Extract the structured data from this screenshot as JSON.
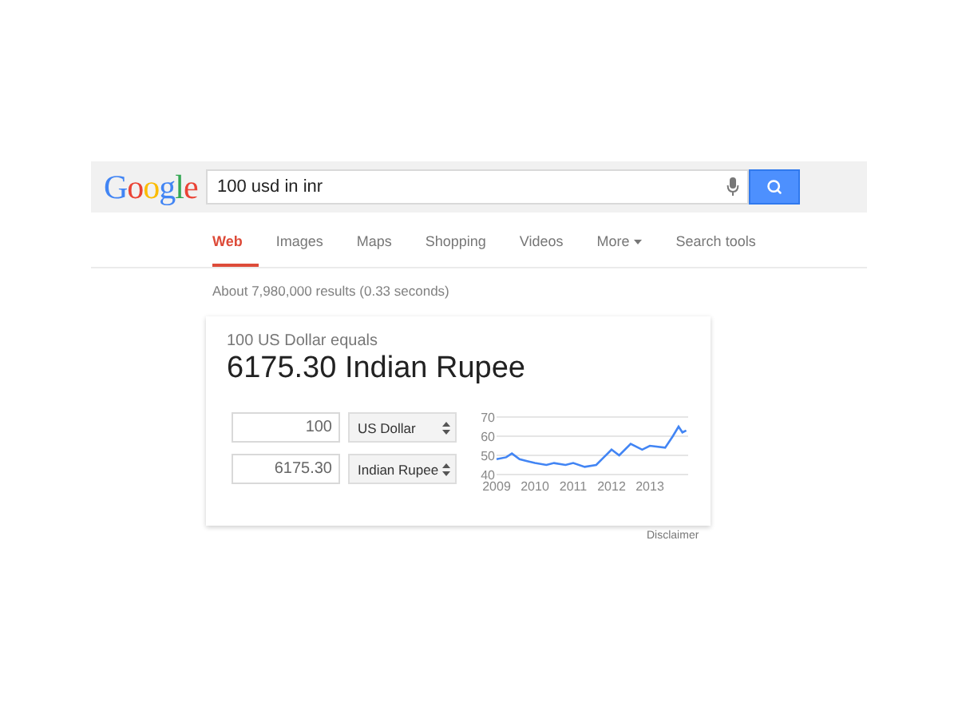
{
  "header": {
    "logo": "Google",
    "query": "100 usd in inr"
  },
  "tabs": [
    {
      "label": "Web",
      "selected": true,
      "dropdown": false
    },
    {
      "label": "Images",
      "selected": false,
      "dropdown": false
    },
    {
      "label": "Maps",
      "selected": false,
      "dropdown": false
    },
    {
      "label": "Shopping",
      "selected": false,
      "dropdown": false
    },
    {
      "label": "Videos",
      "selected": false,
      "dropdown": false
    },
    {
      "label": "More",
      "selected": false,
      "dropdown": true
    },
    {
      "label": "Search tools",
      "selected": false,
      "dropdown": false
    }
  ],
  "result_stats": "About 7,980,000 results (0.33 seconds)",
  "converter": {
    "caption": "100 US Dollar equals",
    "result": "6175.30 Indian Rupee",
    "rows": [
      {
        "amount": "100",
        "currency": "US Dollar"
      },
      {
        "amount": "6175.30",
        "currency": "Indian Rupee"
      }
    ],
    "chart_data": {
      "type": "line",
      "x": [
        2009.0,
        2009.25,
        2009.4,
        2009.6,
        2009.8,
        2010.0,
        2010.3,
        2010.5,
        2010.8,
        2011.0,
        2011.3,
        2011.6,
        2011.8,
        2012.0,
        2012.2,
        2012.5,
        2012.8,
        2013.0,
        2013.4,
        2013.6,
        2013.75,
        2013.85,
        2013.95
      ],
      "series": [
        {
          "color": "#4285f4",
          "values": [
            48,
            49,
            51,
            48,
            47,
            46,
            45,
            46,
            45,
            46,
            44,
            45,
            49,
            53,
            50,
            56,
            53,
            55,
            54,
            60,
            65,
            62,
            63
          ]
        }
      ],
      "xlim": [
        2009,
        2014
      ],
      "ylim": [
        40,
        70
      ],
      "xticks": [
        2009,
        2010,
        2011,
        2012,
        2013
      ],
      "yticks": [
        40,
        50,
        60,
        70
      ]
    }
  },
  "disclaimer": "Disclaimer"
}
